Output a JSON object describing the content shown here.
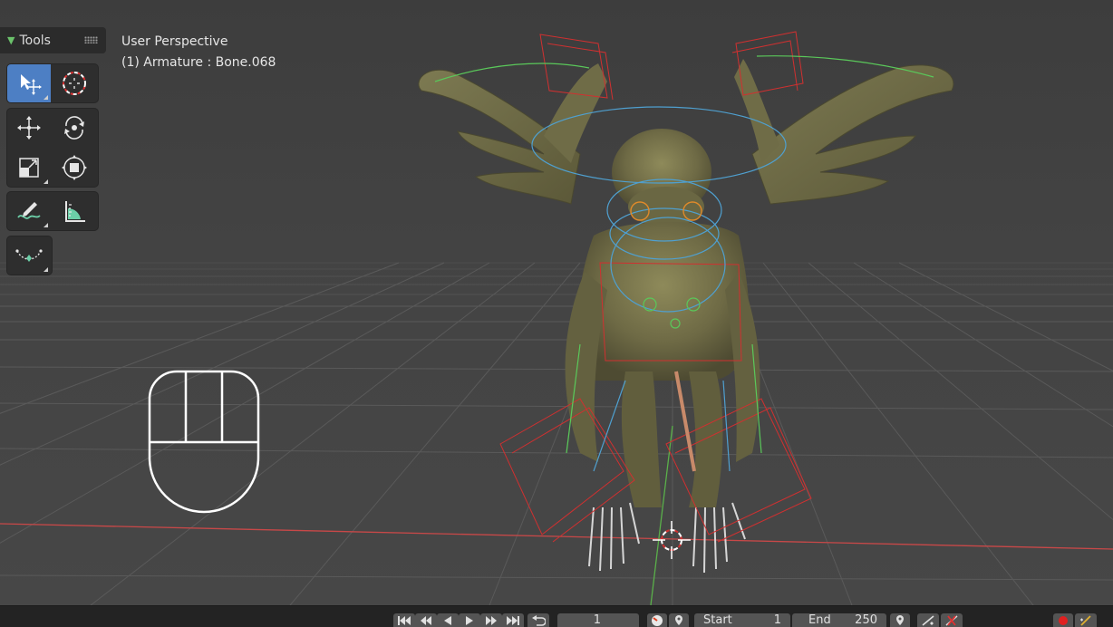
{
  "toolbar": {
    "title": "Tools",
    "tools": [
      {
        "name": "select-box",
        "icon": "select-box-icon",
        "active": true
      },
      {
        "name": "cursor",
        "icon": "cursor-icon",
        "active": false
      },
      {
        "name": "move",
        "icon": "move-icon",
        "active": false
      },
      {
        "name": "rotate",
        "icon": "rotate-icon",
        "active": false
      },
      {
        "name": "scale",
        "icon": "scale-icon",
        "active": false
      },
      {
        "name": "transform",
        "icon": "transform-icon",
        "active": false
      },
      {
        "name": "annotate",
        "icon": "annotate-icon",
        "active": false
      },
      {
        "name": "measure",
        "icon": "measure-icon",
        "active": false
      },
      {
        "name": "bone-envelope",
        "icon": "bone-envelope-icon",
        "active": false
      }
    ]
  },
  "viewport": {
    "view_label": "User Perspective",
    "object_label": "(1) Armature : Bone.068"
  },
  "timeline": {
    "current_frame": "1",
    "start_label": "Start",
    "start_value": "1",
    "end_label": "End",
    "end_value": "250"
  },
  "colors": {
    "accent": "#4d7fc4",
    "record": "#e02020",
    "x_axis": "#c84848",
    "y_axis": "#5ab04a"
  }
}
